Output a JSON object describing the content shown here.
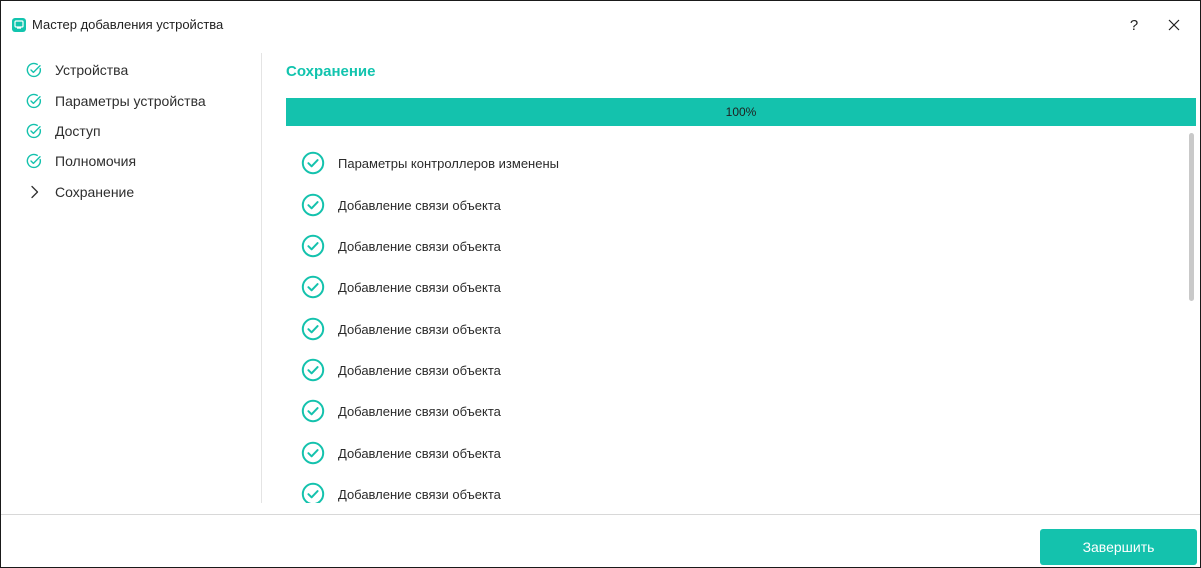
{
  "window": {
    "title": "Мастер добавления устройства",
    "icon": "app-logo-icon",
    "help_label": "?",
    "close_icon": "close-icon"
  },
  "colors": {
    "accent": "#14c2ad",
    "text": "#2b2b2b",
    "divider": "#e4e4e4"
  },
  "steps": [
    {
      "label": "Устройства",
      "state": "done",
      "icon": "check-circle-icon"
    },
    {
      "label": "Параметры устройства",
      "state": "done",
      "icon": "check-circle-icon"
    },
    {
      "label": "Доступ",
      "state": "done",
      "icon": "check-circle-icon"
    },
    {
      "label": "Полномочия",
      "state": "done",
      "icon": "check-circle-icon"
    },
    {
      "label": "Сохранение",
      "state": "current",
      "icon": "chevron-right-icon"
    }
  ],
  "main": {
    "title": "Сохранение",
    "progress": {
      "percent": 100,
      "label": "100%"
    },
    "log": [
      {
        "text": "Параметры контроллеров изменены",
        "status": "success"
      },
      {
        "text": "Добавление связи объекта",
        "status": "success"
      },
      {
        "text": "Добавление связи объекта",
        "status": "success"
      },
      {
        "text": "Добавление связи объекта",
        "status": "success"
      },
      {
        "text": "Добавление связи объекта",
        "status": "success"
      },
      {
        "text": "Добавление связи объекта",
        "status": "success"
      },
      {
        "text": "Добавление связи объекта",
        "status": "success"
      },
      {
        "text": "Добавление связи объекта",
        "status": "success"
      },
      {
        "text": "Добавление связи объекта",
        "status": "success"
      }
    ]
  },
  "footer": {
    "finish_label": "Завершить"
  }
}
